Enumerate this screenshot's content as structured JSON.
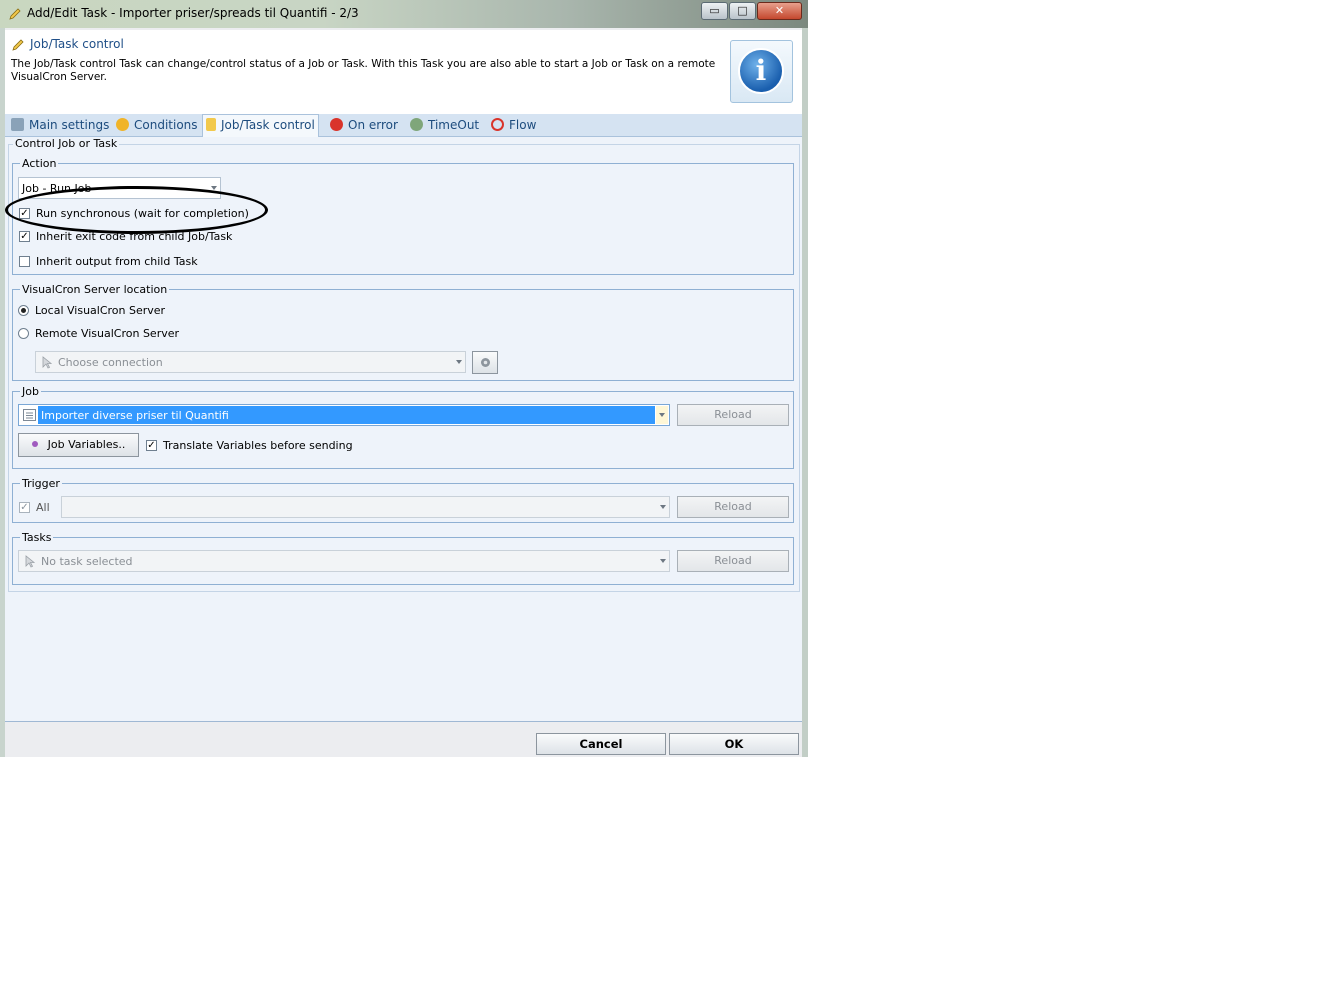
{
  "window": {
    "title": "Add/Edit Task - Importer priser/spreads til Quantifi - 2/3",
    "minimize_glyph": "▭",
    "maximize_glyph": "□",
    "close_glyph": "✕"
  },
  "header": {
    "title": "Job/Task control",
    "description": "The Job/Task control Task can change/control status of a Job or Task. With this Task you are also able to start a Job or Task on a remote VisualCron Server.",
    "info_glyph": "i"
  },
  "tabs": [
    {
      "label": "Main settings",
      "icon": "gears-icon"
    },
    {
      "label": "Conditions",
      "icon": "question-icon"
    },
    {
      "label": "Job/Task control",
      "icon": "pencil-icon"
    },
    {
      "label": "On error",
      "icon": "error-icon"
    },
    {
      "label": "TimeOut",
      "icon": "clock-icon"
    },
    {
      "label": "Flow",
      "icon": "flow-icon"
    }
  ],
  "content": {
    "section_title": "Control Job or Task",
    "action": {
      "group_label": "Action",
      "selected": "Job - Run Job",
      "run_synchronous": {
        "label": "Run synchronous (wait for completion)",
        "checked": true
      },
      "inherit_exit_code": {
        "label": "Inherit exit code from child Job/Task",
        "checked": true
      },
      "inherit_output": {
        "label": "Inherit output from child Task",
        "checked": false
      }
    },
    "server_location": {
      "group_label": "VisualCron Server location",
      "local_label": "Local VisualCron Server",
      "remote_label": "Remote VisualCron Server",
      "connection_placeholder": "Choose connection"
    },
    "job": {
      "group_label": "Job",
      "selected": "Importer diverse priser til Quantifi",
      "reload_label": "Reload",
      "variables_button": "Job Variables..",
      "translate_label": "Translate Variables before sending",
      "translate_checked": true
    },
    "trigger": {
      "group_label": "Trigger",
      "all_label": "All",
      "reload_label": "Reload"
    },
    "tasks": {
      "group_label": "Tasks",
      "placeholder": "No task selected",
      "reload_label": "Reload"
    }
  },
  "footer": {
    "cancel_label": "Cancel",
    "ok_label": "OK"
  },
  "colors": {
    "accent": "#1f4f88",
    "selection": "#3399ff",
    "annotation": "#000000"
  }
}
